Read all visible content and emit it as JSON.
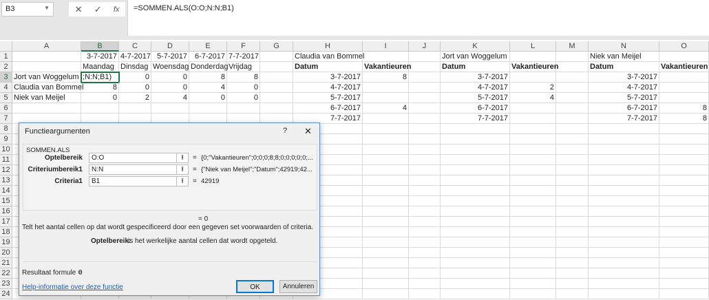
{
  "namebox": "B3",
  "formula_bar": "=SOMMEN.ALS(O:O;N:N;B1)",
  "icons": {
    "cancel": "✕",
    "enter": "✓",
    "fx": "fx"
  },
  "columns": [
    "A",
    "B",
    "C",
    "D",
    "E",
    "F",
    "G",
    "H",
    "I",
    "J",
    "K",
    "L",
    "M",
    "N",
    "O"
  ],
  "rows": [
    [
      "",
      "3-7-2017",
      "4-7-2017",
      "5-7-2017",
      "6-7-2017",
      "7-7-2017",
      "",
      "Claudia van Bommel",
      "",
      "",
      "Jort van Woggelum",
      "",
      "",
      "Niek van Meijel",
      ""
    ],
    [
      "",
      "Maandag",
      "Dinsdag",
      "Woensdag",
      "Donderdag",
      "Vrijdag",
      "",
      "Datum",
      "Vakantieuren",
      "",
      "Datum",
      "Vakantieuren",
      "",
      "Datum",
      "Vakantieuren"
    ],
    [
      "Jort van Woggelum",
      ";N:N;B1)",
      "0",
      "0",
      "8",
      "8",
      "",
      "3-7-2017",
      "8",
      "",
      "3-7-2017",
      "",
      "",
      "3-7-2017",
      ""
    ],
    [
      "Claudia van Bommel",
      "8",
      "0",
      "0",
      "4",
      "0",
      "",
      "4-7-2017",
      "",
      "",
      "4-7-2017",
      "2",
      "",
      "4-7-2017",
      ""
    ],
    [
      "Niek van Meijel",
      "0",
      "2",
      "4",
      "0",
      "0",
      "",
      "5-7-2017",
      "",
      "",
      "5-7-2017",
      "4",
      "",
      "5-7-2017",
      ""
    ],
    [
      "",
      "",
      "",
      "",
      "",
      "",
      "",
      "6-7-2017",
      "4",
      "",
      "6-7-2017",
      "",
      "",
      "6-7-2017",
      "8"
    ],
    [
      "",
      "",
      "",
      "",
      "",
      "",
      "",
      "7-7-2017",
      "",
      "",
      "7-7-2017",
      "",
      "",
      "7-7-2017",
      "8"
    ]
  ],
  "row_count": 24,
  "dialog": {
    "title": "Functieargumenten",
    "help": "?",
    "close": "✕",
    "function": "SOMMEN.ALS",
    "args": [
      {
        "label": "Optelbereik",
        "value": "O:O",
        "result": "{0;\"Vakantieuren\";0;0;0;8;8;0;0;0;0;0;..."
      },
      {
        "label": "Criteriumbereik1",
        "value": "N:N",
        "result": "{\"Niek van Meijel\";\"Datum\";42919;42..."
      },
      {
        "label": "Criteria1",
        "value": "B1",
        "result": "42919"
      }
    ],
    "eq": "=",
    "total": "= 0",
    "description": "Telt het aantal cellen op dat wordt gespecificeerd door een gegeven set voorwaarden of criteria.",
    "arg_help_label": "Optelbereik:",
    "arg_help_text": "is het werkelijke aantal cellen dat wordt opgeteld.",
    "result_label": "Resultaat formule =",
    "result_value": "0",
    "help_link": "Help-informatie over deze functie",
    "ok": "OK",
    "cancel": "Annuleren"
  }
}
